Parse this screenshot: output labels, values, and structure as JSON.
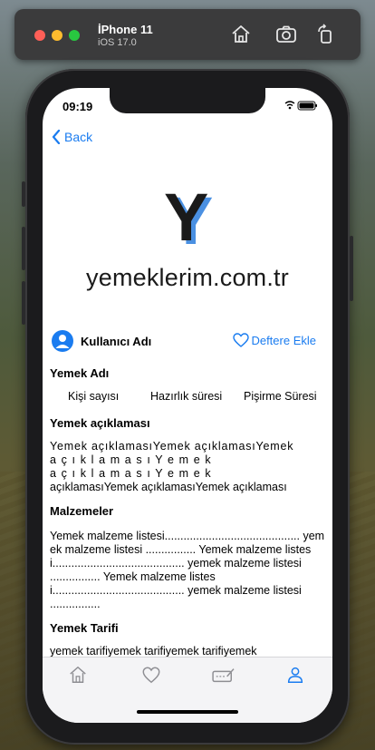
{
  "simulator": {
    "device": "İPhone 11",
    "os": "iOS 17.0",
    "icons": [
      "home-icon",
      "screenshot-icon",
      "rotate-icon"
    ]
  },
  "status": {
    "time": "09:19"
  },
  "nav": {
    "back_label": "Back"
  },
  "logo": {
    "letter": "Y",
    "text": "yemeklerim.com.tr"
  },
  "user": {
    "name": "Kullanıcı Adı",
    "favorite_label": "Deftere Ekle"
  },
  "recipe": {
    "title": "Yemek Adı",
    "servings_label": "Kişi sayısı",
    "prep_label": "Hazırlık süresi",
    "cook_label": "Pişirme Süresi",
    "description_title": "Yemek açıklaması",
    "description_line1": "Yemek açıklamasıYemek açıklamasıYemek",
    "description_line2": "a ç ı k l a m a s ı Y e m e k",
    "description_line3": "a ç ı k l a m a s ı Y e m e k",
    "description_line4": "açıklamasıYemek açıklamasıYemek açıklaması",
    "ingredients_title": "Malzemeler",
    "ingredients_text": "Yemek malzeme listesi........................................... yemek malzeme listesi ................ Yemek malzeme listesi.......................................... yemek malzeme listesi ................ Yemek malzeme listesi.......................................... yemek malzeme listesi ................",
    "steps_title": "Yemek Tarifi",
    "steps_text": "yemek tarifiyemek tarifiyemek tarifiyemek"
  },
  "tabbar": {
    "icons": [
      "home-icon",
      "heart-icon",
      "notebook-pen-icon",
      "person-icon"
    ],
    "active_index": 3
  },
  "colors": {
    "accent": "#1a7cf0",
    "inactive": "#8e8e93"
  }
}
